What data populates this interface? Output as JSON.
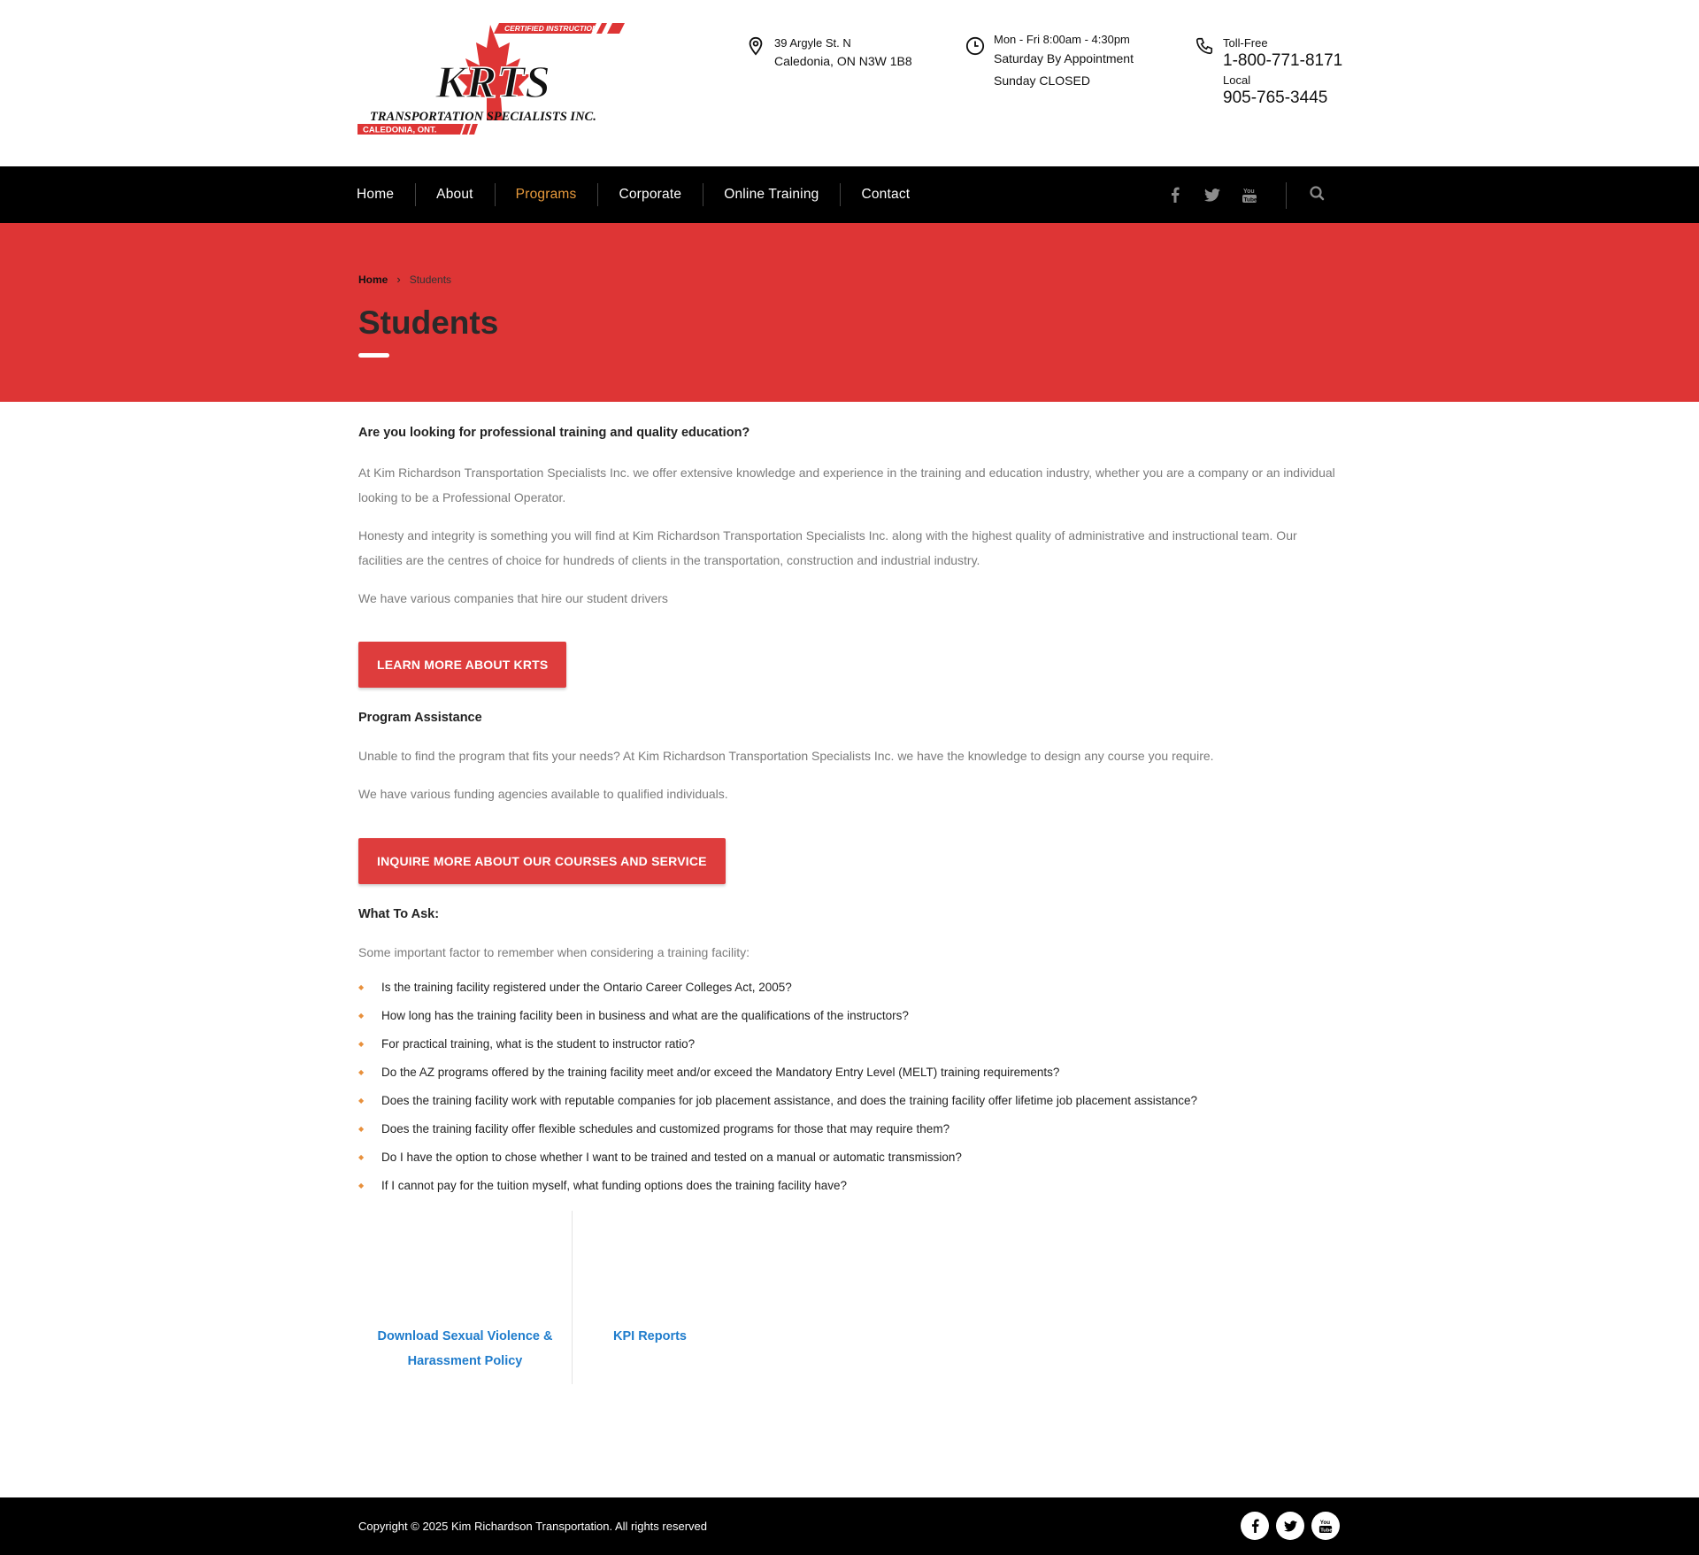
{
  "header": {
    "logo": {
      "top_banner": "CERTIFIED INSTRUCTION",
      "wordmark": "KRTS",
      "company": "TRANSPORTATION SPECIALISTS INC.",
      "location": "CALEDONIA, ONT."
    },
    "address": {
      "line1": "39 Argyle St. N",
      "line2": "Caledonia, ON N3W 1B8",
      "icon": "map-pin-icon"
    },
    "hours": {
      "line1": "Mon - Fri 8:00am - 4:30pm",
      "line2": "Saturday By Appointment",
      "line3": "Sunday CLOSED",
      "icon": "clock-icon"
    },
    "phone": {
      "tollfree_label": "Toll-Free",
      "tollfree": "1-800-771-8171",
      "local_label": "Local",
      "local": "905-765-3445",
      "icon": "phone-icon"
    }
  },
  "nav": {
    "items": [
      {
        "label": "Home",
        "active": false
      },
      {
        "label": "About",
        "active": false
      },
      {
        "label": "Programs",
        "active": true
      },
      {
        "label": "Corporate",
        "active": false
      },
      {
        "label": "Online Training",
        "active": false
      },
      {
        "label": "Contact",
        "active": false
      }
    ],
    "social": [
      "facebook-icon",
      "twitter-icon",
      "youtube-icon"
    ],
    "search_icon": "search-icon",
    "active_color": "#e89a3c"
  },
  "banner": {
    "breadcrumb_home": "Home",
    "breadcrumb_sep": "›",
    "breadcrumb_current": "Students",
    "title": "Students",
    "color": "#de3535"
  },
  "content": {
    "heading1": "Are you looking for professional training and quality education?",
    "para1": "At Kim Richardson Transportation Specialists Inc. we offer extensive knowledge and experience in the training and education industry, whether you are a company or an individual looking to be a Professional Operator.",
    "para2": "Honesty and integrity is something you will find at Kim Richardson Transportation Specialists Inc. along with the highest quality of administrative and instructional team. Our  facilities are the centres of choice for hundreds of clients in the transportation, construction and industrial industry.",
    "para3": "We have various companies that hire our student drivers",
    "button1": "LEARN MORE ABOUT KRTS",
    "heading2": "Program Assistance",
    "para4": "Unable to find the program that fits your needs? At Kim Richardson Transportation Specialists Inc. we have the knowledge to design any course you require.",
    "para5": "We have various funding agencies available to qualified individuals.",
    "button2": "INQUIRE MORE ABOUT OUR COURSES AND SERVICE",
    "heading3": "What To Ask:",
    "para6": "Some important factor to remember when considering a training facility:",
    "questions": [
      "Is the training facility registered under the Ontario Career Colleges Act, 2005?",
      "How long has the training facility been in business and what are the qualifications of the instructors?",
      "For practical training, what is the student to instructor ratio?",
      "Do the AZ programs offered by the training facility meet and/or exceed the Mandatory Entry Level (MELT) training requirements?",
      "Does the training facility work with reputable companies for job placement assistance, and does the training facility offer lifetime job placement assistance?",
      "Does the training facility offer flexible schedules and customized programs for those that may require them?",
      "Do I have the option to chose whether I want to be trained and tested on a manual or automatic transmission?",
      "If I cannot pay for the tuition myself, what funding options does the training facility have?"
    ],
    "link_policy_line1": "Download Sexual Violence &",
    "link_policy_line2": "Harassment Policy",
    "link_kpi": "KPI Reports",
    "button_color": "#de3d3d",
    "bullet_color": "#e8903c",
    "link_color": "#1f7ccc"
  },
  "footer": {
    "copyright": "Copyright © 2025 Kim Richardson Transportation. All rights reserved",
    "social": [
      "facebook-icon",
      "twitter-icon",
      "youtube-icon"
    ]
  }
}
